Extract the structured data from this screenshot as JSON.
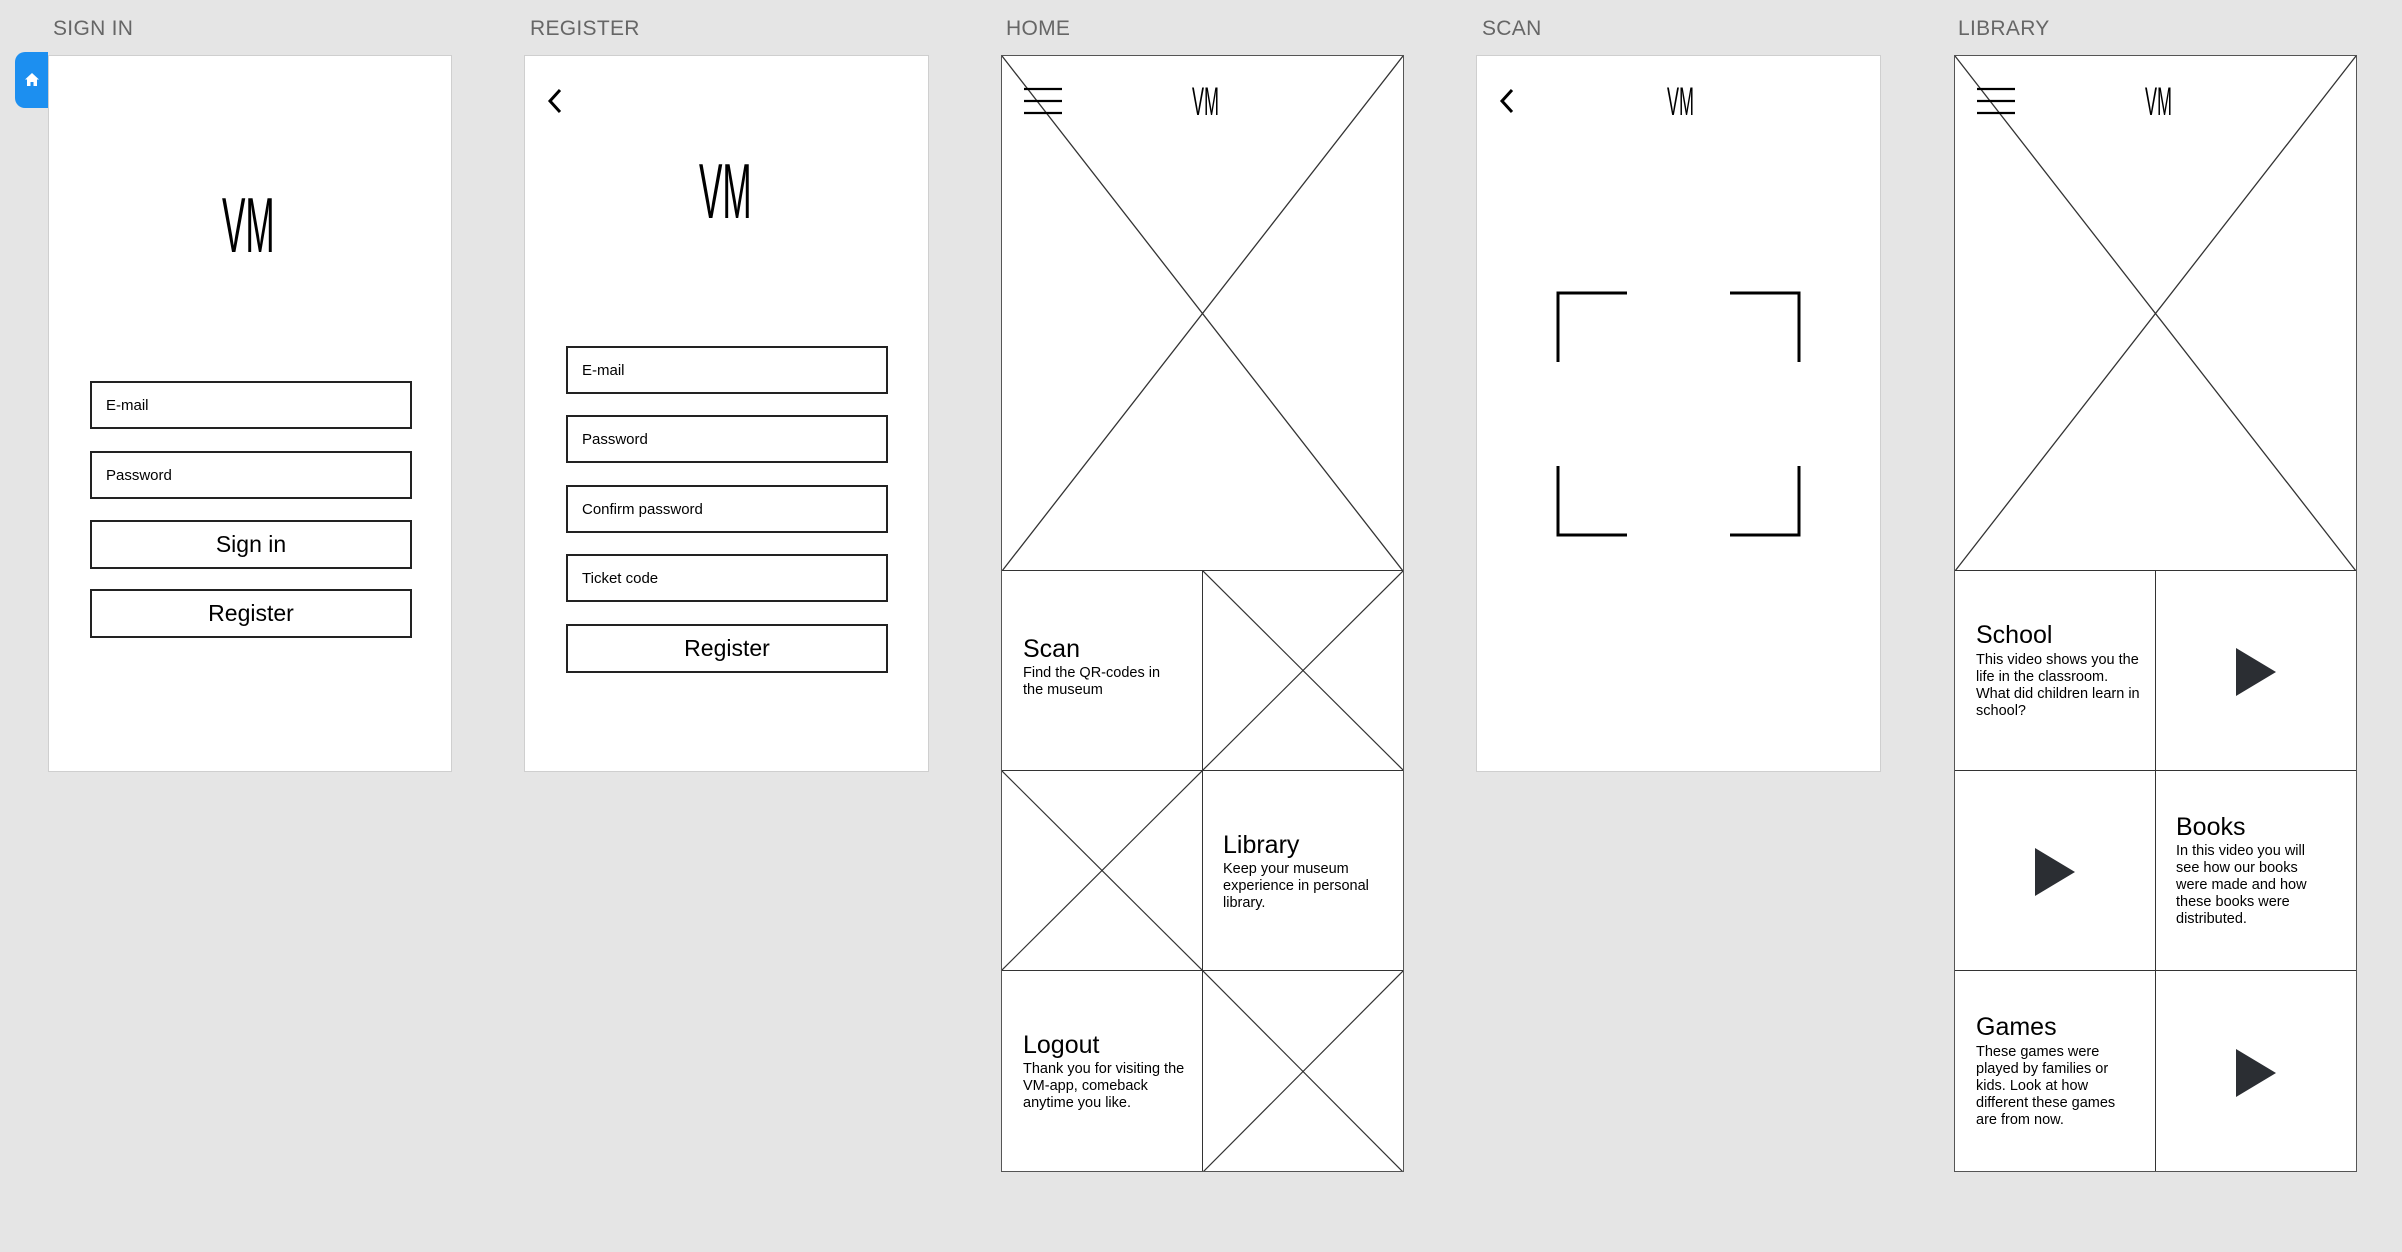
{
  "boards": {
    "signin": {
      "label": "SIGN IN",
      "logo": "VM",
      "email_placeholder": "E-mail",
      "password_placeholder": "Password",
      "signin_label": "Sign in",
      "register_label": "Register"
    },
    "register": {
      "label": "REGISTER",
      "logo": "VM",
      "email_placeholder": "E-mail",
      "password_placeholder": "Password",
      "confirm_placeholder": "Confirm password",
      "ticket_placeholder": "Ticket code",
      "register_label": "Register"
    },
    "home": {
      "label": "HOME",
      "logo": "VM",
      "tiles": [
        {
          "title": "Scan",
          "desc": "Find the QR-codes in the museum"
        },
        {
          "title": "Library",
          "desc": "Keep your museum experience in personal library."
        },
        {
          "title": "Logout",
          "desc": "Thank you for visiting the VM-app, comeback anytime you like."
        }
      ]
    },
    "scan": {
      "label": "SCAN",
      "logo": "VM"
    },
    "library": {
      "label": "LIBRARY",
      "logo": "VM",
      "videos": [
        {
          "title": "School",
          "desc": "This video shows you the life in the classroom. What did children learn in school?"
        },
        {
          "title": "Books",
          "desc": "In this video you will see how our books were made and how these books were distributed."
        },
        {
          "title": "Games",
          "desc": "These games were played by families or kids. Look at how different these games are from now."
        }
      ]
    }
  },
  "colors": {
    "canvas": "#e5e5e5",
    "home_tab": "#1c8ff0",
    "play_icon": "#2b2e33"
  }
}
